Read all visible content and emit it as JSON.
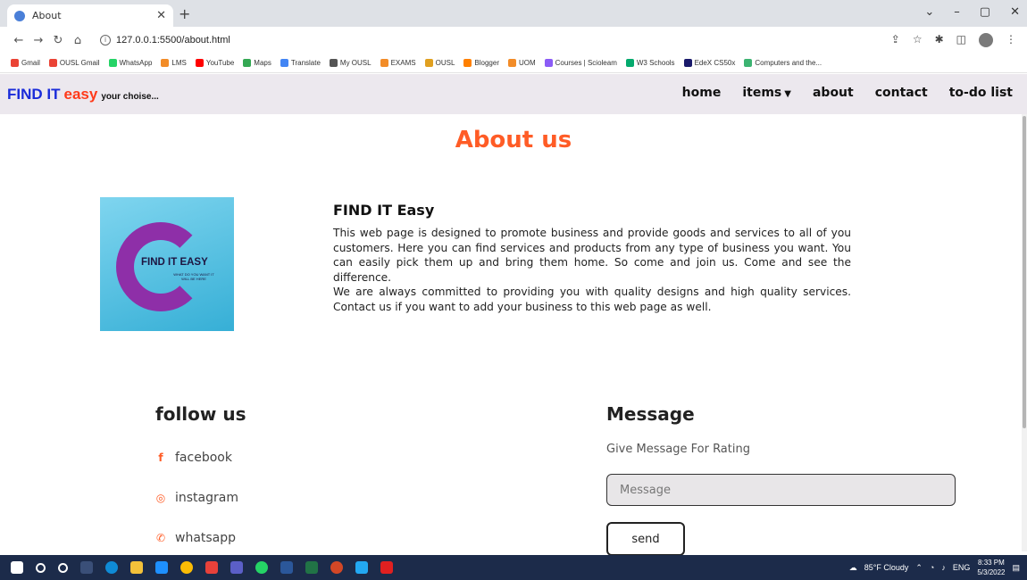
{
  "browser": {
    "tab_title": "About",
    "url": "127.0.0.1:5500/about.html",
    "bookmarks": [
      {
        "label": "Gmail",
        "color": "#ea4335"
      },
      {
        "label": "OUSL Gmail",
        "color": "#ea4335"
      },
      {
        "label": "WhatsApp",
        "color": "#25d366"
      },
      {
        "label": "LMS",
        "color": "#f28c28"
      },
      {
        "label": "YouTube",
        "color": "#ff0000"
      },
      {
        "label": "Maps",
        "color": "#34a853"
      },
      {
        "label": "Translate",
        "color": "#4285f4"
      },
      {
        "label": "My OUSL",
        "color": "#555555"
      },
      {
        "label": "EXAMS",
        "color": "#f28c28"
      },
      {
        "label": "OUSL",
        "color": "#e0a020"
      },
      {
        "label": "Blogger",
        "color": "#ff8000"
      },
      {
        "label": "UOM",
        "color": "#f28c28"
      },
      {
        "label": "Courses | Scioleam",
        "color": "#8b5cf6"
      },
      {
        "label": "W3 Schools",
        "color": "#04aa6d"
      },
      {
        "label": "EdeX CS50x",
        "color": "#1a1a6b"
      },
      {
        "label": "Computers and the...",
        "color": "#3cb371"
      }
    ]
  },
  "site": {
    "brand_main": "FIND IT",
    "brand_accent": "easy",
    "brand_tagline": "your choise...",
    "nav": {
      "home": "home",
      "items": "items",
      "about": "about",
      "contact": "contact",
      "todo": "to-do list"
    }
  },
  "page": {
    "title": "About us",
    "logo": {
      "text": "FIND IT EASY",
      "subtext": "WHAT DO YOU WANT IT WILL BE HERE"
    },
    "about_heading": "FIND IT Easy",
    "about_p1": "This web page is designed to promote business and provide goods and services to all of you customers. Here you can find services and products from any type of business you want. You can easily pick them up and bring them home. So come and join us. Come and see the difference.",
    "about_p2": "We are always committed to providing you with quality designs and high quality services. Contact us if you want to add your business to this web page as well.",
    "follow_heading": "follow us",
    "social": {
      "facebook": "facebook",
      "instagram": "instagram",
      "whatsapp": "whatsapp"
    },
    "message_heading": "Message",
    "message_sub": "Give Message For Rating",
    "message_placeholder": "Message",
    "send_label": "send"
  },
  "taskbar": {
    "weather": "85°F Cloudy",
    "lang": "ENG",
    "time": "8:33 PM",
    "date": "5/3/2022"
  },
  "colors": {
    "accent": "#ff5c26",
    "brand_blue": "#1a2bd9",
    "nav_bg": "#ece8ee",
    "taskbar_bg": "#1c2b4a"
  }
}
